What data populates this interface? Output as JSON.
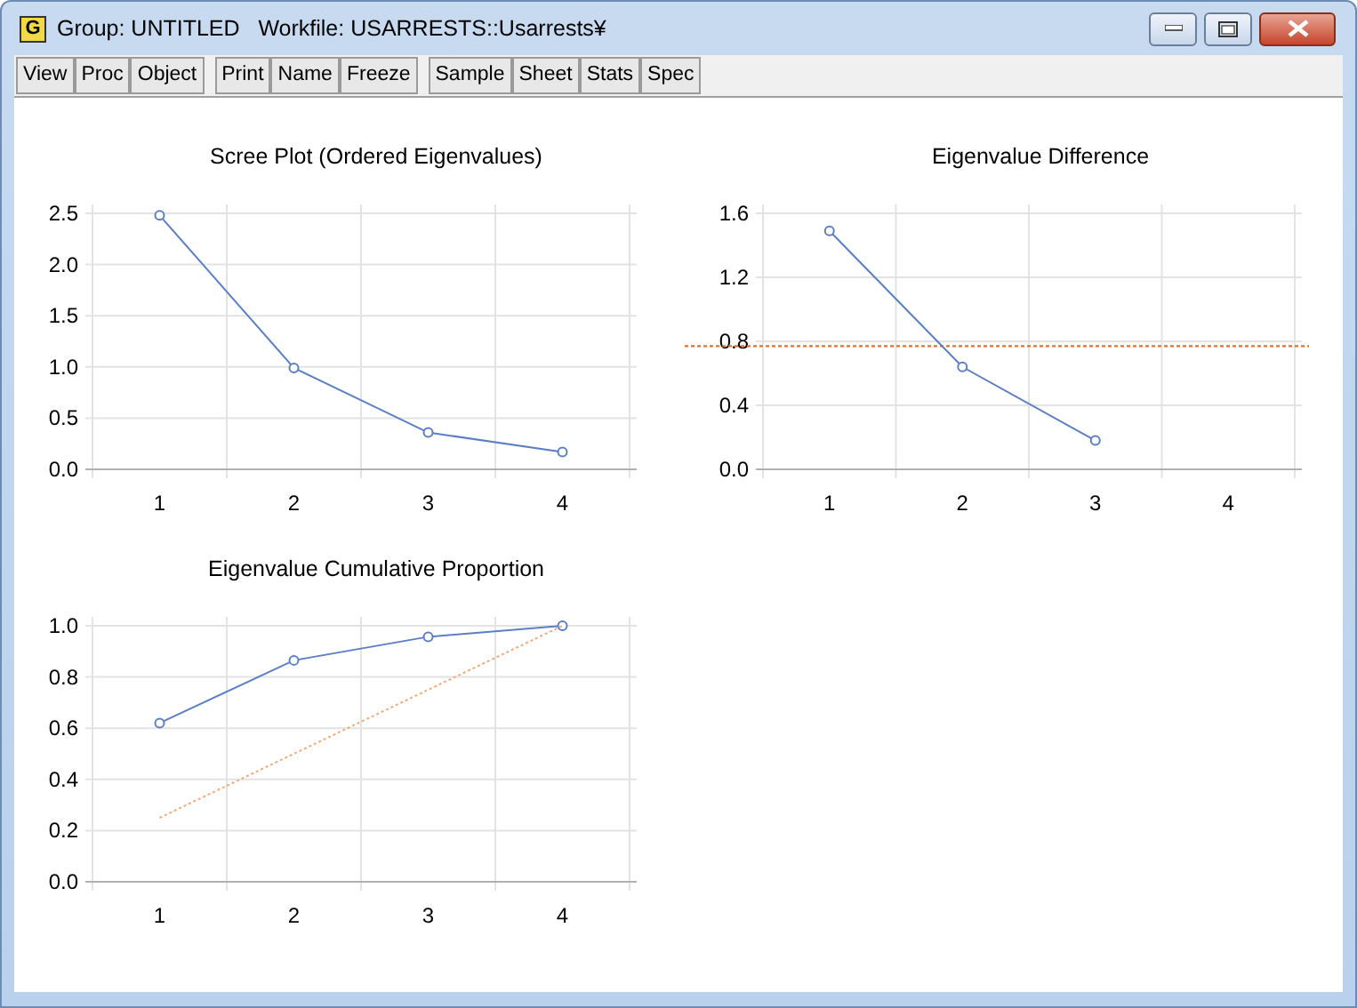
{
  "window": {
    "icon_letter": "G",
    "title": "Group: UNTITLED   Workfile: USARRESTS::Usarrests¥"
  },
  "toolbar": [
    [
      "View",
      "Proc",
      "Object"
    ],
    [
      "Print",
      "Name",
      "Freeze"
    ],
    [
      "Sample",
      "Sheet",
      "Stats",
      "Spec"
    ]
  ],
  "charts": [
    {
      "chart_data": {
        "type": "line",
        "title": "Scree Plot (Ordered Eigenvalues)",
        "categories": [
          "1",
          "2",
          "3",
          "4"
        ],
        "ylim": [
          0,
          2.5
        ],
        "grid": true,
        "yticks": [
          {
            "value": 0,
            "label": "0.0"
          },
          {
            "value": 0.5,
            "label": "0.5"
          },
          {
            "value": 1,
            "label": "1.0"
          },
          {
            "value": 1.5,
            "label": "1.5"
          },
          {
            "value": 2,
            "label": "2.0"
          },
          {
            "value": 2.5,
            "label": "2.5"
          }
        ],
        "series": [
          {
            "color": "#5b7fc4",
            "line_style": "solid",
            "marker": "o",
            "values": [
              2.48,
              0.99,
              0.36,
              0.17
            ]
          }
        ]
      }
    },
    {
      "chart_data": {
        "type": "line",
        "title": "Eigenvalue Difference",
        "categories": [
          "1",
          "2",
          "3",
          "4"
        ],
        "ylim": [
          0,
          1.6
        ],
        "grid": true,
        "yticks": [
          {
            "value": 0,
            "label": "0.0"
          },
          {
            "value": 0.4,
            "label": "0.4"
          },
          {
            "value": 0.8,
            "label": "0.8"
          },
          {
            "value": 1.2,
            "label": "1.2"
          },
          {
            "value": 1.6,
            "label": "1.6"
          }
        ],
        "series": [
          {
            "color": "#5b7fc4",
            "line_style": "solid",
            "marker": "o",
            "values": [
              1.49,
              0.64,
              0.18,
              null
            ]
          }
        ],
        "ref_lines": [
          {
            "axis": "y",
            "value": 0.77,
            "color": "#d9752e"
          }
        ]
      }
    },
    {
      "chart_data": {
        "type": "line",
        "title": "Eigenvalue Cumulative Proportion",
        "categories": [
          "1",
          "2",
          "3",
          "4"
        ],
        "ylim": [
          0,
          1.0
        ],
        "grid": true,
        "yticks": [
          {
            "value": 0,
            "label": "0.0"
          },
          {
            "value": 0.2,
            "label": "0.2"
          },
          {
            "value": 0.4,
            "label": "0.4"
          },
          {
            "value": 0.6,
            "label": "0.6"
          },
          {
            "value": 0.8,
            "label": "0.8"
          },
          {
            "value": 1,
            "label": "1.0"
          }
        ],
        "series": [
          {
            "color": "#5b7fc4",
            "line_style": "solid",
            "marker": "o",
            "values": [
              0.62,
              0.865,
              0.957,
              1.0
            ]
          },
          {
            "color": "#f2a97a",
            "line_style": "dotted",
            "values": [
              0.25,
              0.5,
              0.75,
              1.0
            ]
          }
        ]
      }
    }
  ]
}
